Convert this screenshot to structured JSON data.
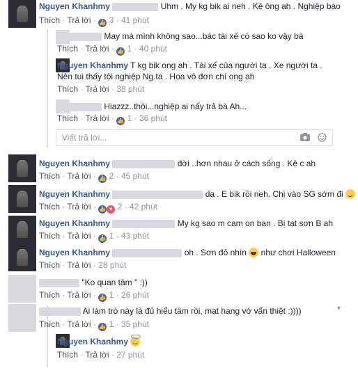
{
  "comments": [
    {
      "name": "Nguyen Khanhmy",
      "text": "Uhm . My kg bik ai neh . Kệ ông ah . Nghiệp báo",
      "like_label": "Thích",
      "reply_label": "Trả lời",
      "count": "3",
      "time": "41 phút"
    },
    {
      "text": "May mà mình không sao...bác tài xế có sao ko vậy bà",
      "like_label": "Thích",
      "reply_label": "Trả lời",
      "count": "1",
      "time": "40 phút"
    },
    {
      "name": "Nguyen Khanhmy",
      "text_line1": "T kg bik ong ah . Tài xế của người ta . Xe người ta .",
      "text_line2": "Nên tui thấy tội nghiệp Ng.ta . Họa vô đơn chí ong ah",
      "like_label": "Thích",
      "reply_label": "Trả lời",
      "time": "38 phút"
    },
    {
      "text": "Hiazzz..thôi...nghiệp ai nấy trả bà Ah...",
      "like_label": "Thích",
      "reply_label": "Trả lời",
      "count": "1",
      "time": "36 phút"
    },
    {
      "name": "Nguyen Khanhmy",
      "text": "đời ..hơn nhau ở cách sống . Kệ c ah",
      "like_label": "Thích",
      "reply_label": "Trả lời",
      "count": "2",
      "time": "45 phút"
    },
    {
      "name": "Nguyen Khanhmy",
      "text": "dạ . E bik rồi neh. Chị vào SG sớm đi",
      "like_label": "Thích",
      "reply_label": "Trả lời",
      "count": "2",
      "time": "42 phút"
    },
    {
      "name": "Nguyen Khanhmy",
      "text": "My kg sao m cam on ban . Bị tạt sơn B ah",
      "like_label": "Thích",
      "reply_label": "Trả lời",
      "count": "1",
      "time": "43 phút"
    },
    {
      "name": "Nguyen Khanhmy",
      "text_a": "oh . Sơn đỏ nhìn",
      "text_b": "như chơi Halloween",
      "like_label": "Thích",
      "reply_label": "Trả lời",
      "time": "28 phút"
    },
    {
      "text": "\"Ko quan tâm \" :))",
      "like_label": "Thích",
      "reply_label": "Trả lời",
      "count": "1",
      "time": "26 phút"
    },
    {
      "text": "Ai làm trò này là đủ hiểu tầm rồi, mạt hạng vớ vẩn thiệt :))))",
      "like_label": "Thích",
      "reply_label": "Trả lời",
      "count": "1",
      "time": "35 phút"
    },
    {
      "name": "Nguyen Khanhmy",
      "like_label": "Thích",
      "reply_label": "Trả lời",
      "time": "27 phút"
    }
  ],
  "reply_box": {
    "placeholder": "Viết trả lời..."
  },
  "colors": {
    "name": "#365899",
    "link_blue": "#4267b2",
    "meta": "#90949c"
  }
}
